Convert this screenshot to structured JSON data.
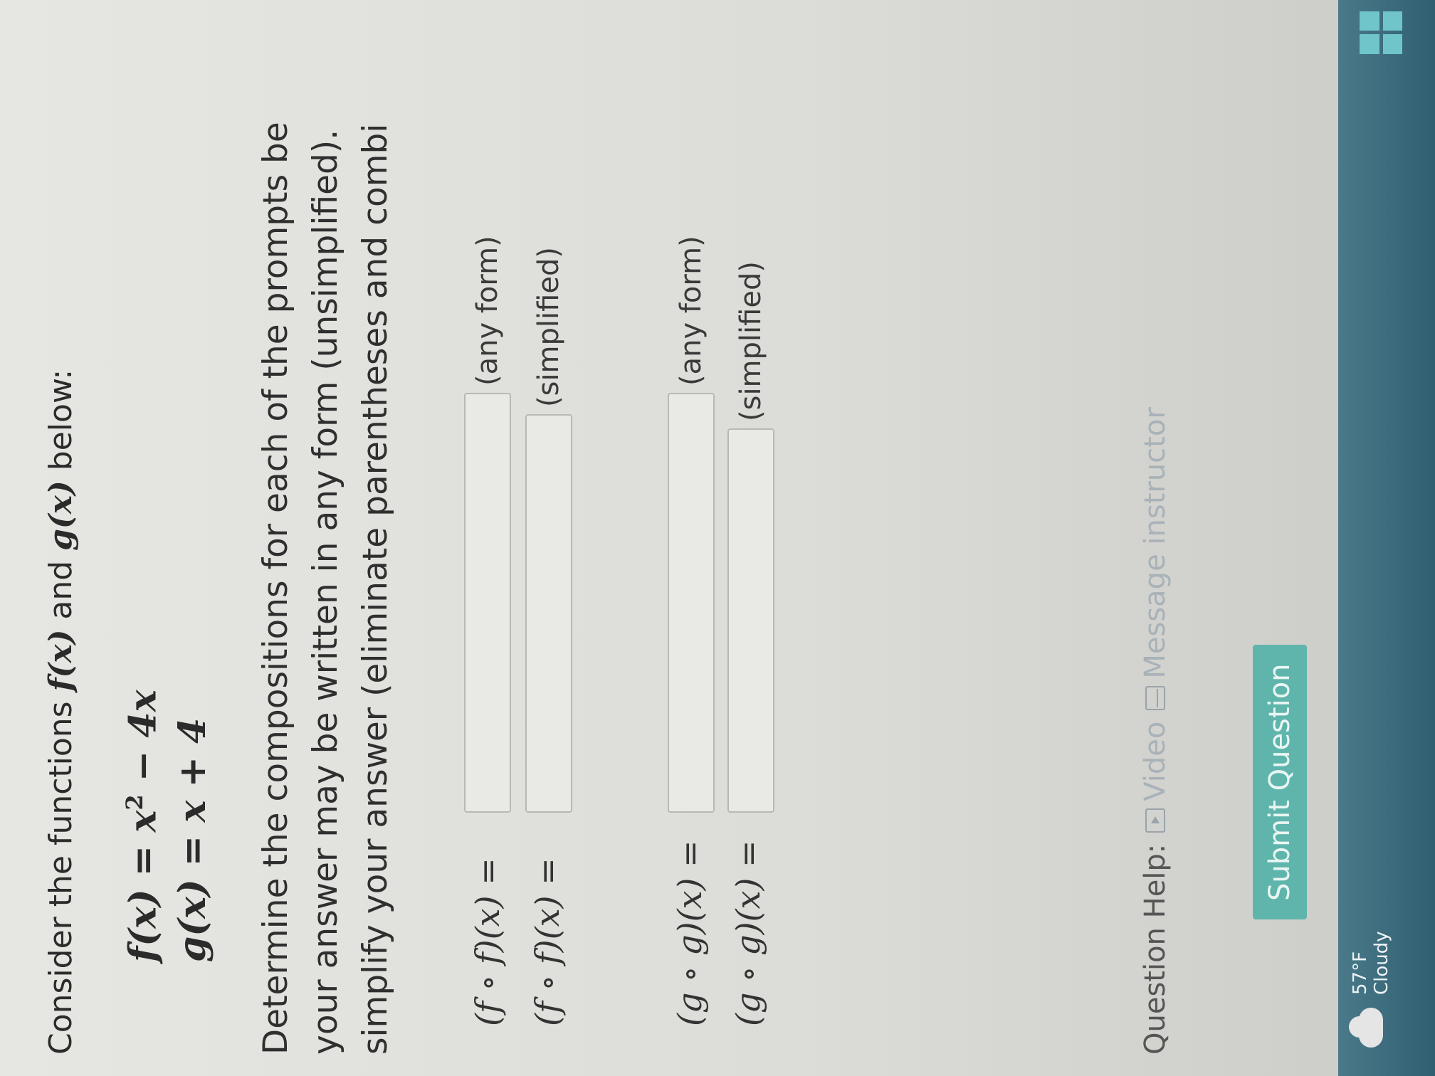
{
  "intro": {
    "prefix": "Consider the functions ",
    "f_name": "f(x)",
    "mid": " and ",
    "g_name": "g(x)",
    "suffix": " below:"
  },
  "functions": [
    {
      "lhs": "f(x)",
      "eq": " = ",
      "base": "x",
      "exp": "2",
      "rest": " − 4x"
    },
    {
      "lhs": "g(x)",
      "eq": " = ",
      "base": "x",
      "exp": "",
      "rest": " + 4"
    }
  ],
  "instructions": [
    "Determine the compositions for each of the prompts be",
    "your answer may be written in any form (unsimplified).",
    "simplify your answer (eliminate parentheses and combi"
  ],
  "prompts": [
    {
      "label": "(f ∘ f)(x) =",
      "hint": "(any form)"
    },
    {
      "label": "(f ∘ f)(x) =",
      "hint": "(simplified)"
    },
    {
      "label": "(g ∘ g)(x) =",
      "hint": "(any form)"
    },
    {
      "label": "(g ∘ g)(x) =",
      "hint": "(simplified)"
    }
  ],
  "help": {
    "label": "Question Help:",
    "video": "Video",
    "message": "Message instructor"
  },
  "submit_label": "Submit Question",
  "taskbar": {
    "temperature": "57°F",
    "condition": "Cloudy"
  },
  "colors": {
    "submit_bg": "#5fb5ab",
    "taskbar_bg": "#2f5f70",
    "link": "#a8b2b8"
  }
}
